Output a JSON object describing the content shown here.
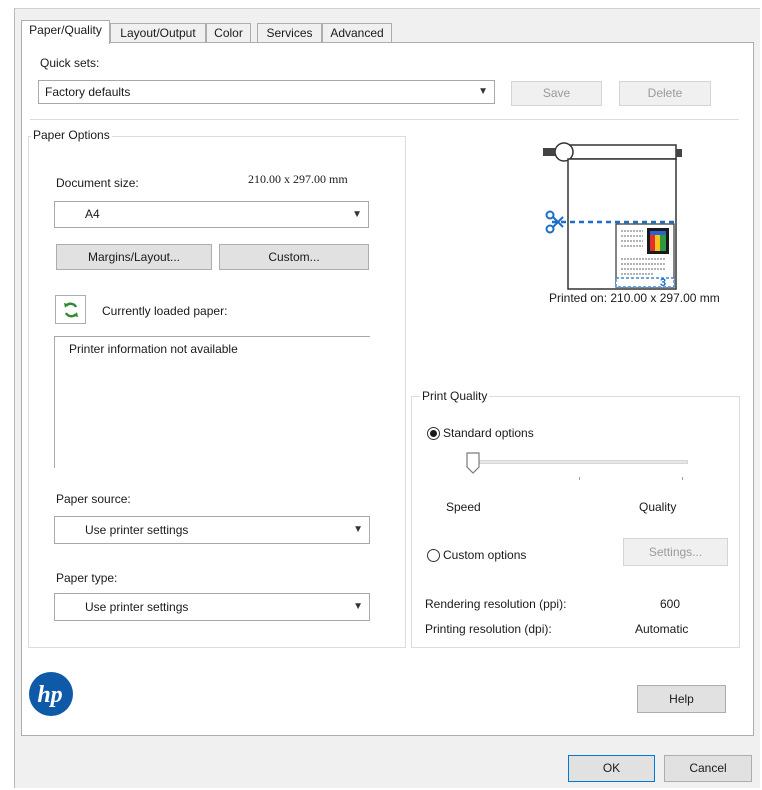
{
  "tabs": [
    {
      "label": "Paper/Quality"
    },
    {
      "label": "Layout/Output"
    },
    {
      "label": "Color"
    },
    {
      "label": "Services"
    },
    {
      "label": "Advanced"
    }
  ],
  "quick_sets": {
    "label": "Quick sets:",
    "selected": "Factory defaults",
    "save_label": "Save",
    "delete_label": "Delete"
  },
  "paper_options": {
    "title": "Paper Options",
    "document_size_label": "Document size:",
    "document_size_value": "210.00 x 297.00 mm",
    "document_size_selected": "A4",
    "margins_button": "Margins/Layout...",
    "custom_button": "Custom...",
    "currently_loaded_label": "Currently loaded paper:",
    "printer_info": "Printer information not available",
    "paper_source_label": "Paper source:",
    "paper_source_selected": "Use printer settings",
    "paper_type_label": "Paper type:",
    "paper_type_selected": "Use printer settings"
  },
  "preview": {
    "printed_on": "Printed on: 210.00 x 297.00 mm",
    "page_number": "3"
  },
  "print_quality": {
    "title": "Print Quality",
    "standard_label": "Standard options",
    "standard_checked": true,
    "slider_min_label": "Speed",
    "slider_max_label": "Quality",
    "slider_level": 0,
    "custom_label": "Custom options",
    "custom_checked": false,
    "settings_button": "Settings...",
    "rendering_label": "Rendering resolution (ppi):",
    "rendering_value": "600",
    "printing_label": "Printing resolution (dpi):",
    "printing_value": "Automatic"
  },
  "footer": {
    "logo_text": "hp",
    "help_label": "Help",
    "ok_label": "OK",
    "cancel_label": "Cancel"
  },
  "colors": {
    "hp_blue": "#0f5aa8",
    "refresh_green": "#2e8b2e",
    "preview_dash_blue": "#1c6fc9"
  }
}
